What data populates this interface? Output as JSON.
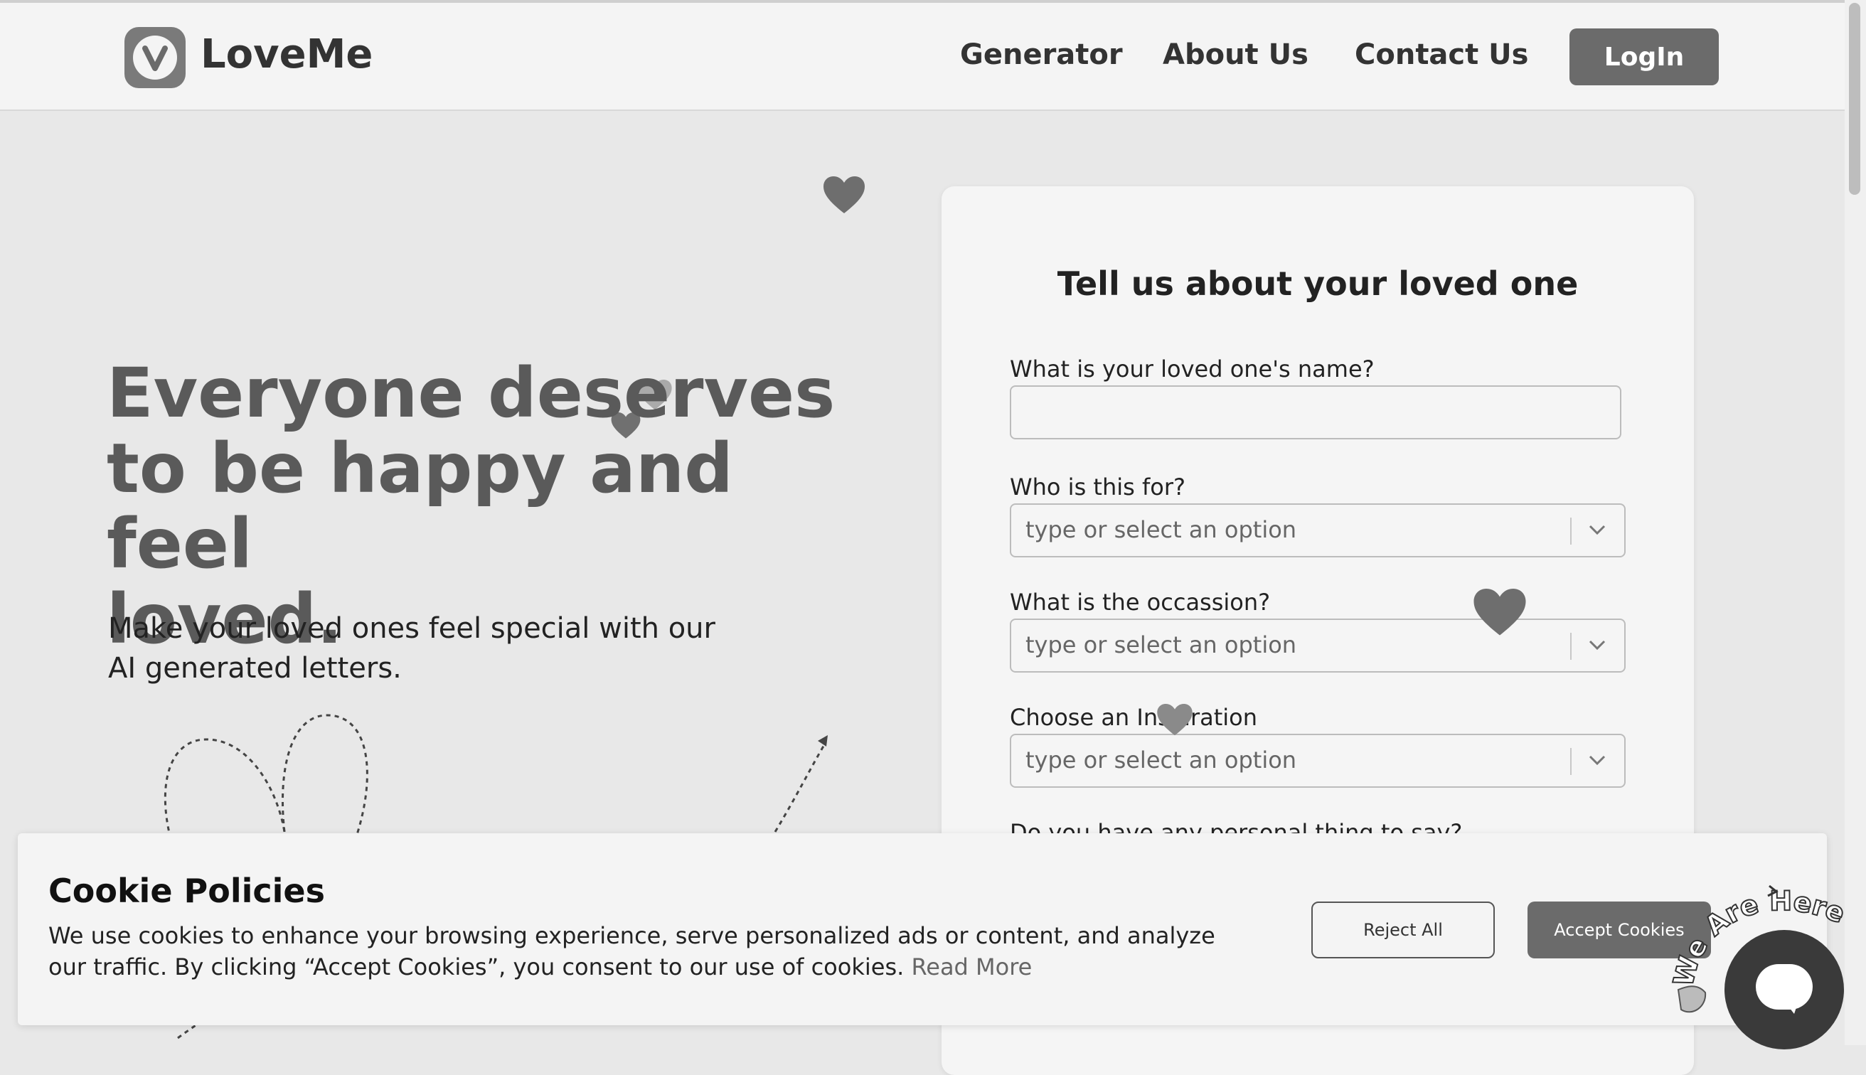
{
  "header": {
    "brand": "LoveMe",
    "nav": [
      "Generator",
      "About Us",
      "Contact Us"
    ],
    "login_label": "LogIn"
  },
  "hero": {
    "title_lines": [
      "Everyone deserves",
      "to be happy and feel",
      "loved."
    ],
    "subtitle": "Make your loved ones feel special with our AI generated letters."
  },
  "form": {
    "title": "Tell us about your loved one",
    "name_label": "What is your loved one's name?",
    "name_value": "",
    "who_label": "Who is this for?",
    "occasion_label": "What is the occassion?",
    "inspiration_label": "Choose an Inspiration",
    "select_placeholder": "type or select an option",
    "personal_label": "Do you have any personal thing to say?"
  },
  "cookie": {
    "title": "Cookie Policies",
    "text": "We use cookies to enhance your browsing experience, serve personalized ads or content, and analyze our traffic. By clicking “Accept Cookies”, you consent to our use of cookies.",
    "read_more": "Read More",
    "reject_label": "Reject All",
    "accept_label": "Accept Cookies"
  },
  "chat": {
    "badge_text": "We Are Here!"
  },
  "colors": {
    "accent": "#6b6b6b",
    "heading": "#5a5a5a",
    "background": "#e8e8e8"
  }
}
